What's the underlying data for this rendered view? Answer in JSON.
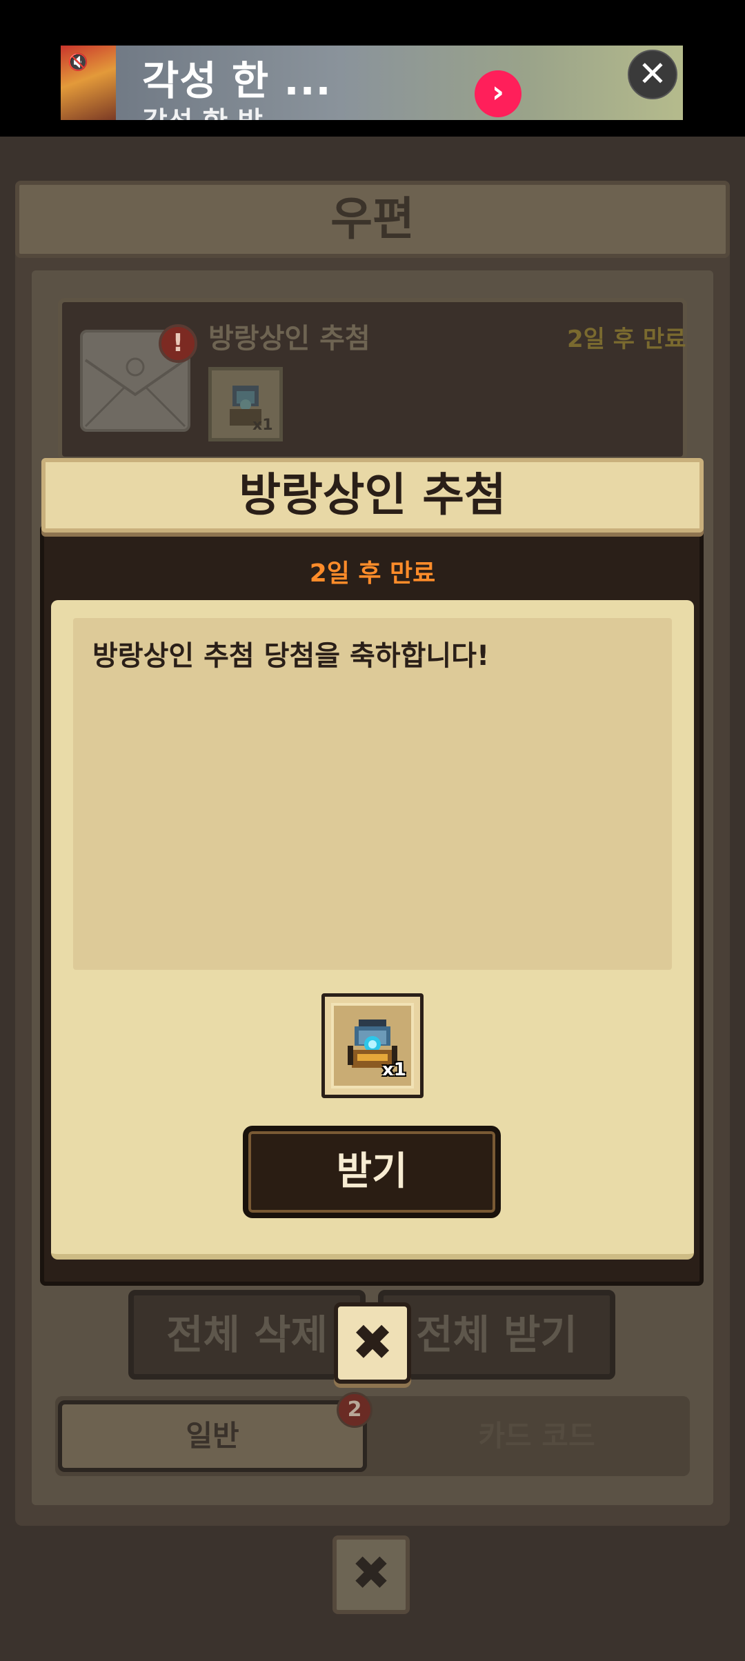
{
  "ad": {
    "title": "각성 한 ...",
    "subtitle": "각성 한 방",
    "go_glyph": "›",
    "close_glyph": "✕",
    "mute_glyph": "🔇"
  },
  "mailbox": {
    "title": "우편",
    "item": {
      "title": "방랑상인 추첨",
      "expiry": "2일 후 만료",
      "alert_glyph": "!",
      "reward_qty": "x1"
    },
    "delete_all": "전체 삭제",
    "receive_all": "전체 받기",
    "tabs": {
      "general": "일반",
      "general_badge": "2",
      "card_code": "카드 코드"
    },
    "close_glyph": "✖"
  },
  "modal": {
    "title": "방랑상인 추첨",
    "expiry": "2일 후 만료",
    "message": "방랑상인 추첨 당첨을 축하합니다!",
    "reward_qty": "x1",
    "receive_label": "받기",
    "close_glyph": "✖"
  },
  "colors": {
    "expiry_accent": "#ff8c2a",
    "ad_go_button": "#ff1f5a"
  }
}
